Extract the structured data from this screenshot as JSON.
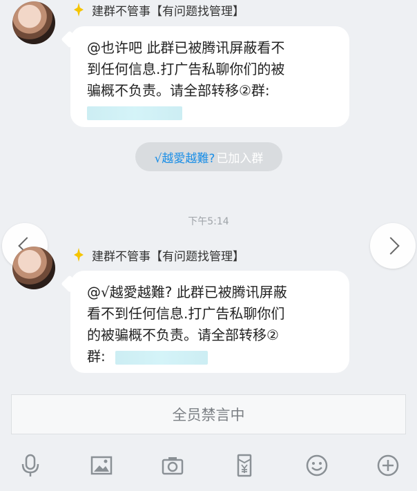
{
  "messages": [
    {
      "sender": "建群不管事【有问题找管理】",
      "text_lines": [
        "@也许吧 此群已被腾讯屏蔽看不",
        "到任何信息.打广告私聊你们的被",
        "骗概不负责。请全部转移②群:"
      ]
    },
    {
      "sender": "建群不管事【有问题找管理】",
      "text_lines": [
        "@√越愛越難? 此群已被腾讯屏蔽",
        "看不到任何信息.打广告私聊你们",
        "的被骗概不负责。请全部转移②",
        "群:"
      ]
    }
  ],
  "system_notice": {
    "user": "√越愛越難?",
    "text": "已加入群"
  },
  "timestamp": "下午5:14",
  "mute_bar": {
    "label": "全员禁言中"
  },
  "toolbar": {
    "icons": [
      "microphone-icon",
      "image-icon",
      "camera-icon",
      "red-packet-icon",
      "emoji-icon",
      "plus-icon"
    ]
  },
  "colors": {
    "background": "#eef0f3",
    "bubble": "#ffffff",
    "accent_blue": "#1a8ee6",
    "badge_yellow": "#f5c400"
  }
}
